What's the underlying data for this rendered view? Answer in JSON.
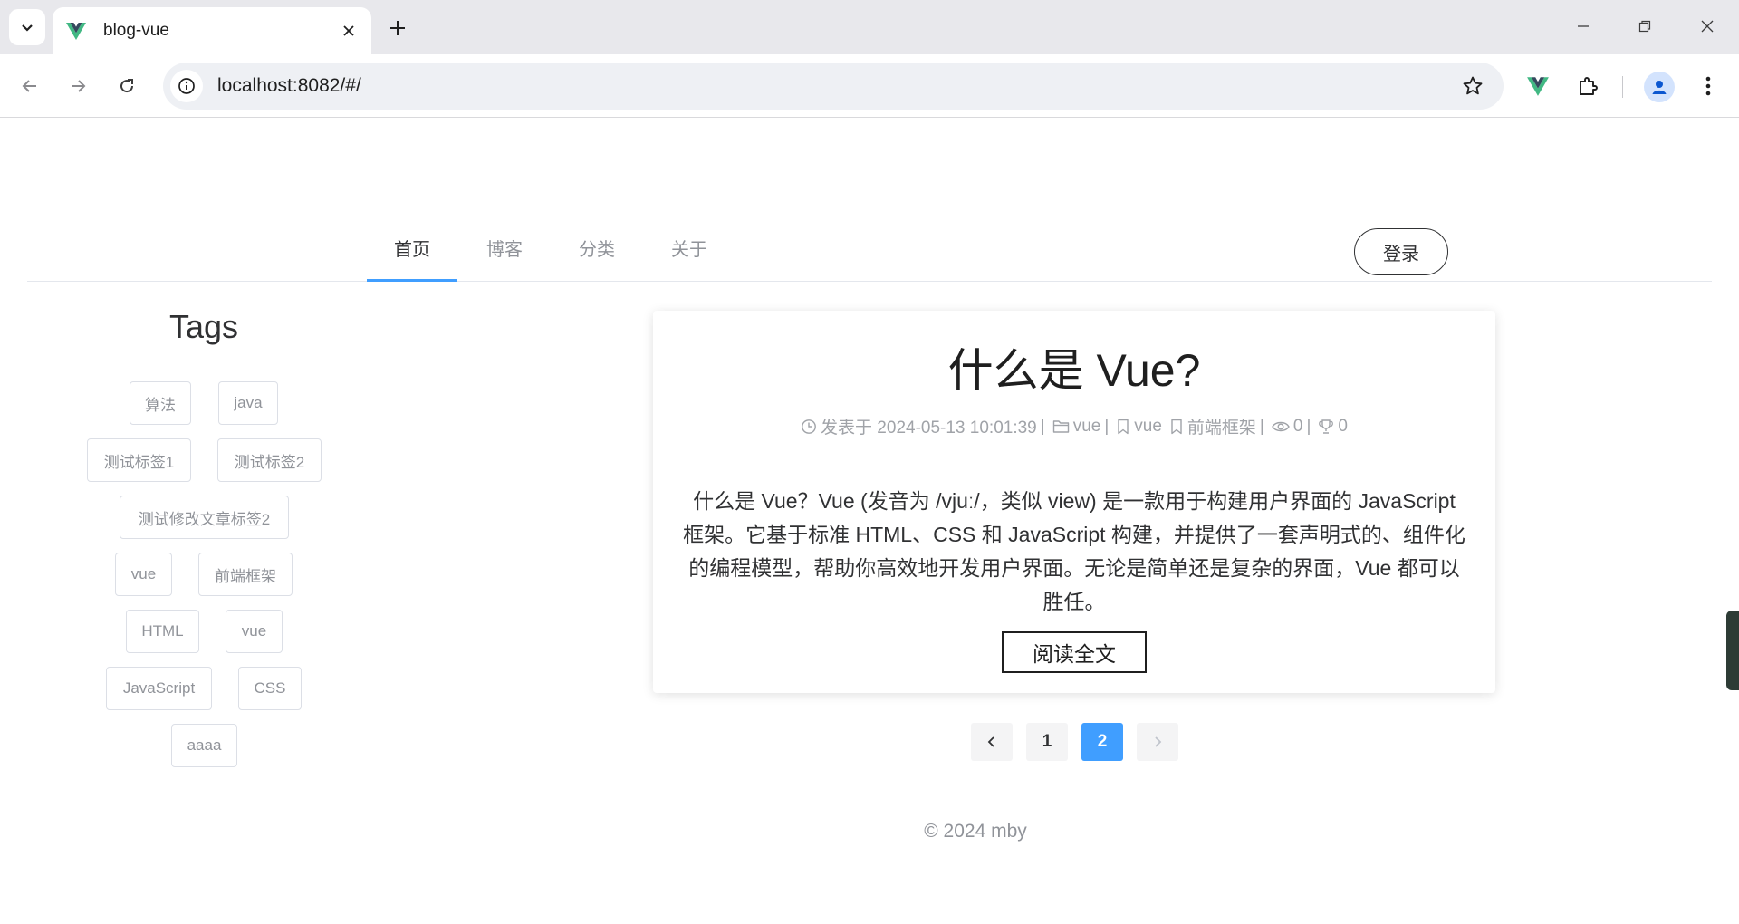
{
  "browser": {
    "tab_title": "blog-vue",
    "url": "localhost:8082/#/",
    "icons": [
      "chevron-down-icon",
      "vue-logo-icon",
      "close-icon",
      "plus-icon",
      "minimize-icon",
      "restore-icon",
      "window-close-icon",
      "back-icon",
      "forward-icon",
      "reload-icon",
      "site-info-icon",
      "bookmark-star-icon",
      "vue-devtools-icon",
      "extensions-icon",
      "profile-icon",
      "more-vert-icon"
    ]
  },
  "nav": {
    "items": [
      {
        "label": "首页",
        "active": true
      },
      {
        "label": "博客",
        "active": false
      },
      {
        "label": "分类",
        "active": false
      },
      {
        "label": "关于",
        "active": false
      }
    ],
    "login_label": "登录",
    "accent_color": "#409eff"
  },
  "sidebar": {
    "title": "Tags",
    "tags": [
      "算法",
      "java",
      "测试标签1",
      "测试标签2",
      "测试修改文章标签2",
      "vue",
      "前端框架",
      "HTML",
      "vue",
      "JavaScript",
      "CSS",
      "aaaa"
    ]
  },
  "post": {
    "title": "什么是 Vue?",
    "published": "发表于 2024-05-13 10:01:39",
    "category": "vue",
    "tag1": "vue",
    "tag2": "前端框架",
    "views": "0",
    "likes": "0",
    "summary": "什么是 Vue？Vue (发音为 /vjuː/，类似 view) 是一款用于构建用户界面的 JavaScript 框架。它基于标准 HTML、CSS 和 JavaScript 构建，并提供了一套声明式的、组件化的编程模型，帮助你高效地开发用户界面。无论是简单还是复杂的界面，Vue 都可以胜任。",
    "read_more": "阅读全文"
  },
  "pagination": {
    "pages": [
      "1",
      "2"
    ],
    "current_page": 2
  },
  "footer": {
    "text": "© 2024 mby"
  }
}
